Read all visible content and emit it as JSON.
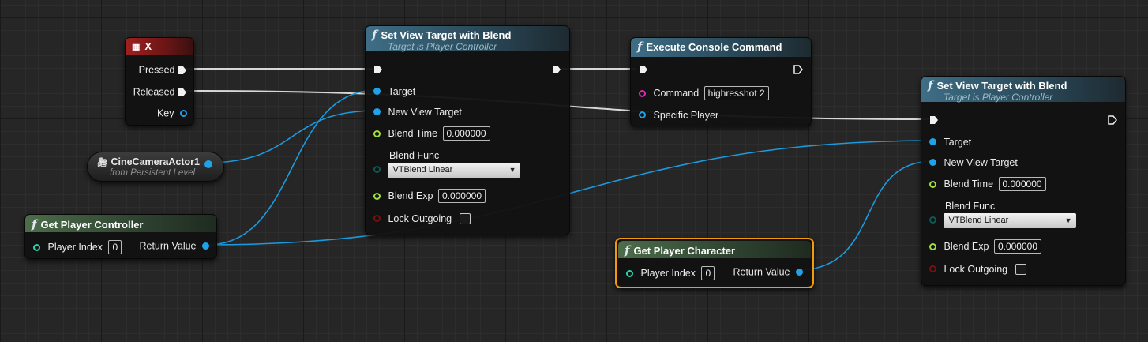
{
  "wire_colors": {
    "exec": "#dcdcdc",
    "object": "#1a9be0"
  },
  "key_node": {
    "title": "X",
    "icon": "keyboard-icon",
    "pins": {
      "pressed": "Pressed",
      "released": "Released",
      "key": "Key"
    }
  },
  "camera_node": {
    "title": "CineCameraActor1",
    "subtitle": "from Persistent Level",
    "icon": "camera-icon"
  },
  "get_controller_node": {
    "title": "Get Player Controller",
    "player_index_label": "Player Index",
    "player_index_value": "0",
    "return_label": "Return Value"
  },
  "set_view_1": {
    "title": "Set View Target with Blend",
    "subtitle": "Target is Player Controller",
    "target": "Target",
    "new_view_target": "New View Target",
    "blend_time_label": "Blend Time",
    "blend_time_value": "0.000000",
    "blend_func_label": "Blend Func",
    "blend_func_value": "VTBlend Linear",
    "blend_exp_label": "Blend Exp",
    "blend_exp_value": "0.000000",
    "lock_outgoing": "Lock Outgoing"
  },
  "console_node": {
    "title": "Execute Console Command",
    "command_label": "Command",
    "command_value": "highresshot 2",
    "specific_player": "Specific Player"
  },
  "set_view_2": {
    "title": "Set View Target with Blend",
    "subtitle": "Target is Player Controller",
    "target": "Target",
    "new_view_target": "New View Target",
    "blend_time_label": "Blend Time",
    "blend_time_value": "0.000000",
    "blend_func_label": "Blend Func",
    "blend_func_value": "VTBlend Linear",
    "blend_exp_label": "Blend Exp",
    "blend_exp_value": "0.000000",
    "lock_outgoing": "Lock Outgoing"
  },
  "get_character_node": {
    "title": "Get Player Character",
    "player_index_label": "Player Index",
    "player_index_value": "0",
    "return_label": "Return Value"
  }
}
